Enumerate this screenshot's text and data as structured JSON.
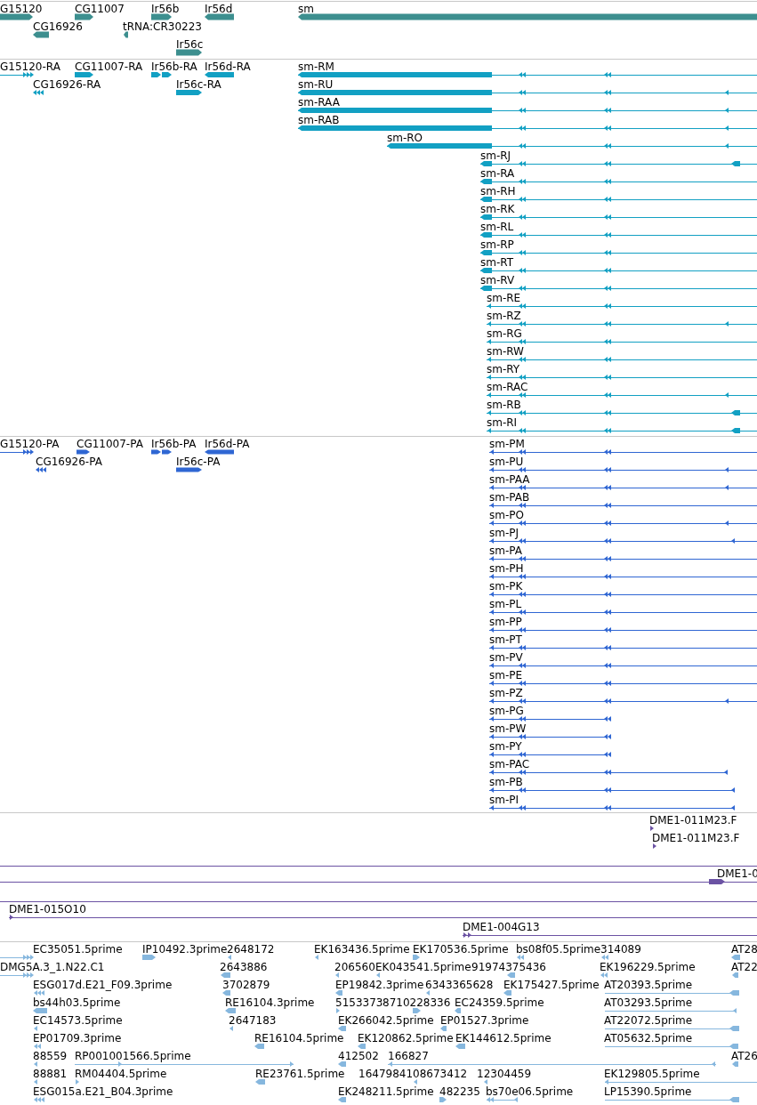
{
  "tracks": [
    {
      "kind": "genes",
      "color": "#3d8f8f",
      "features": [
        {
          "label": "G15120",
          "reverse": false
        },
        {
          "label": "CG11007",
          "reverse": false
        },
        {
          "label": "Ir56b",
          "reverse": false
        },
        {
          "label": "Ir56d",
          "reverse": true
        },
        {
          "label": "sm",
          "reverse": true
        },
        {
          "label": "CG16926",
          "reverse": true
        },
        {
          "label": "tRNA:CR30223",
          "reverse": true
        },
        {
          "label": "Ir56c",
          "reverse": false
        }
      ]
    },
    {
      "kind": "transcripts",
      "color": "#12a0c3",
      "features": [
        {
          "label": "G15120-RA",
          "reverse": false
        },
        {
          "label": "CG11007-RA",
          "reverse": false
        },
        {
          "label": "Ir56b-RA",
          "reverse": false
        },
        {
          "label": "Ir56d-RA",
          "reverse": true
        },
        {
          "label": "CG16926-RA",
          "reverse": true
        },
        {
          "label": "Ir56c-RA",
          "reverse": false
        },
        {
          "label": "sm-RM",
          "reverse": true
        },
        {
          "label": "sm-RU",
          "reverse": true
        },
        {
          "label": "sm-RAA",
          "reverse": true
        },
        {
          "label": "sm-RAB",
          "reverse": true
        },
        {
          "label": "sm-RO",
          "reverse": true
        },
        {
          "label": "sm-RJ",
          "reverse": true
        },
        {
          "label": "sm-RA",
          "reverse": true
        },
        {
          "label": "sm-RH",
          "reverse": true
        },
        {
          "label": "sm-RK",
          "reverse": true
        },
        {
          "label": "sm-RL",
          "reverse": true
        },
        {
          "label": "sm-RP",
          "reverse": true
        },
        {
          "label": "sm-RT",
          "reverse": true
        },
        {
          "label": "sm-RV",
          "reverse": true
        },
        {
          "label": "sm-RE",
          "reverse": true
        },
        {
          "label": "sm-RZ",
          "reverse": true
        },
        {
          "label": "sm-RG",
          "reverse": true
        },
        {
          "label": "sm-RW",
          "reverse": true
        },
        {
          "label": "sm-RY",
          "reverse": true
        },
        {
          "label": "sm-RAC",
          "reverse": true
        },
        {
          "label": "sm-RB",
          "reverse": true
        },
        {
          "label": "sm-RI",
          "reverse": true
        }
      ]
    },
    {
      "kind": "proteins",
      "color": "#2f66d3",
      "features": [
        {
          "label": "G15120-PA",
          "reverse": false
        },
        {
          "label": "CG11007-PA",
          "reverse": false
        },
        {
          "label": "Ir56b-PA",
          "reverse": false
        },
        {
          "label": "Ir56d-PA",
          "reverse": true
        },
        {
          "label": "CG16926-PA",
          "reverse": true
        },
        {
          "label": "Ir56c-PA",
          "reverse": false
        },
        {
          "label": "sm-PM",
          "reverse": true
        },
        {
          "label": "sm-PU",
          "reverse": true
        },
        {
          "label": "sm-PAA",
          "reverse": true
        },
        {
          "label": "sm-PAB",
          "reverse": true
        },
        {
          "label": "sm-PO",
          "reverse": true
        },
        {
          "label": "sm-PJ",
          "reverse": true
        },
        {
          "label": "sm-PA",
          "reverse": true
        },
        {
          "label": "sm-PH",
          "reverse": true
        },
        {
          "label": "sm-PK",
          "reverse": true
        },
        {
          "label": "sm-PL",
          "reverse": true
        },
        {
          "label": "sm-PP",
          "reverse": true
        },
        {
          "label": "sm-PT",
          "reverse": true
        },
        {
          "label": "sm-PV",
          "reverse": true
        },
        {
          "label": "sm-PE",
          "reverse": true
        },
        {
          "label": "sm-PZ",
          "reverse": true
        },
        {
          "label": "sm-PG",
          "reverse": true
        },
        {
          "label": "sm-PW",
          "reverse": true
        },
        {
          "label": "sm-PY",
          "reverse": true
        },
        {
          "label": "sm-PAC",
          "reverse": true
        },
        {
          "label": "sm-PB",
          "reverse": true
        },
        {
          "label": "sm-PI",
          "reverse": true
        }
      ]
    },
    {
      "kind": "clones",
      "color": "#6b52a3",
      "features": [
        {
          "label": "DME1-011M23.F",
          "reverse": false
        },
        {
          "label": "DME1-011M23.F",
          "reverse": false
        }
      ]
    },
    {
      "kind": "clones",
      "color": "#6b52a3",
      "features": [
        {
          "label": "DME1-0",
          "reverse": false
        }
      ]
    },
    {
      "kind": "clones",
      "color": "#6b52a3",
      "features": [
        {
          "label": "DME1-015O10",
          "reverse": false
        },
        {
          "label": "DME1-004G13",
          "reverse": false
        }
      ]
    },
    {
      "kind": "est",
      "color": "#86b7de",
      "features": [
        {
          "label": "EC35051.5prime",
          "reverse": false
        },
        {
          "label": "IP10492.3prime",
          "reverse": false
        },
        {
          "label": "2648172",
          "reverse": true
        },
        {
          "label": "EK163436.5prime",
          "reverse": true
        },
        {
          "label": "EK170536.5prime",
          "reverse": false
        },
        {
          "label": "bs08f05.5prime",
          "reverse": true
        },
        {
          "label": "314089",
          "reverse": true
        },
        {
          "label": "AT28",
          "reverse": true
        },
        {
          "label": "DMG5A.3_1.N22.C1",
          "reverse": false
        },
        {
          "label": "2643886",
          "reverse": true
        },
        {
          "label": "206560",
          "reverse": true
        },
        {
          "label": "EK043541.5prime",
          "reverse": true
        },
        {
          "label": "91974375436",
          "reverse": true
        },
        {
          "label": "EK196229.5prime",
          "reverse": true
        },
        {
          "label": "AT22",
          "reverse": true
        },
        {
          "label": "ESG017d.E21_F09.3prime",
          "reverse": true
        },
        {
          "label": "3702879",
          "reverse": true
        },
        {
          "label": "EP19842.3prime",
          "reverse": true
        },
        {
          "label": "6343365628",
          "reverse": true
        },
        {
          "label": "EK175427.5prime",
          "reverse": true
        },
        {
          "label": "AT20393.5prime",
          "reverse": true
        },
        {
          "label": "bs44h03.5prime",
          "reverse": true
        },
        {
          "label": "RE16104.3prime",
          "reverse": true
        },
        {
          "label": "5153373",
          "reverse": false
        },
        {
          "label": "8710228336",
          "reverse": false
        },
        {
          "label": "EC24359.5prime",
          "reverse": true
        },
        {
          "label": "AT03293.5prime",
          "reverse": true
        },
        {
          "label": "EC14573.5prime",
          "reverse": true
        },
        {
          "label": "2647183",
          "reverse": true
        },
        {
          "label": "EK266042.5prime",
          "reverse": true
        },
        {
          "label": "EP01527.3prime",
          "reverse": true
        },
        {
          "label": "AT22072.5prime",
          "reverse": true
        },
        {
          "label": "EP01709.3prime",
          "reverse": true
        },
        {
          "label": "RE16104.5prime",
          "reverse": true
        },
        {
          "label": "EK120862.5prime",
          "reverse": true
        },
        {
          "label": "EK144612.5prime",
          "reverse": true
        },
        {
          "label": "AT05632.5prime",
          "reverse": true
        },
        {
          "label": "88559",
          "reverse": true
        },
        {
          "label": "RP001001566.5prime",
          "reverse": false
        },
        {
          "label": "412502",
          "reverse": true
        },
        {
          "label": "166827",
          "reverse": true
        },
        {
          "label": "AT26",
          "reverse": true
        },
        {
          "label": "88881",
          "reverse": true
        },
        {
          "label": "RM04404.5prime",
          "reverse": false
        },
        {
          "label": "RE23761.5prime",
          "reverse": true
        },
        {
          "label": "1647984108673412",
          "reverse": true
        },
        {
          "label": "12304459",
          "reverse": true
        },
        {
          "label": "EK129805.5prime",
          "reverse": true
        },
        {
          "label": "ESG015a.E21_B04.3prime",
          "reverse": true
        },
        {
          "label": "EK248211.5prime",
          "reverse": true
        },
        {
          "label": "482235",
          "reverse": false
        },
        {
          "label": "bs70e06.5prime",
          "reverse": true
        },
        {
          "label": "LP15390.5prime",
          "reverse": true
        }
      ]
    }
  ]
}
